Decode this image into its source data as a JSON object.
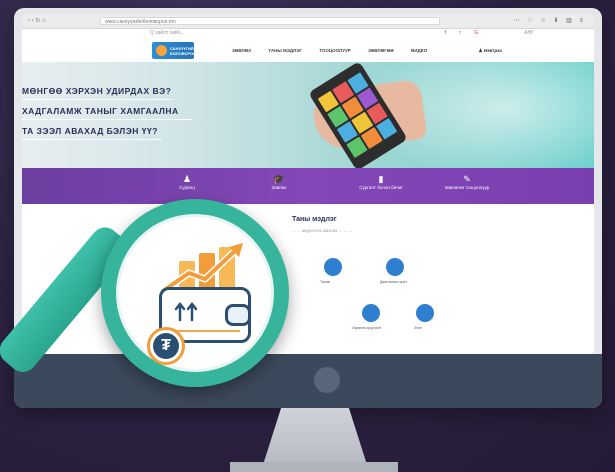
{
  "browser": {
    "nav_controls": "‹ › ↻ ⌂",
    "url": "www.санхүүгийнболовсрол.mn",
    "toolbar_icons": "⋯ ♡ ☆   ⬇ ▥ ≡"
  },
  "site": {
    "top": {
      "search_placeholder": "Q  хайлт хийх...",
      "social": [
        "f",
        "t",
        "G"
      ],
      "lang": "АНГ"
    },
    "logo_text": "САНХҮҮГИЙН БОЛОВСРОЛ",
    "menu": [
      "ЗӨВЛӨХ",
      "ТАНЫ МЭДЛЭГ",
      "ТООЦООЛУУР",
      "ЗӨВЛӨГӨӨ",
      "ВИДЕО"
    ],
    "login": "♟ Нэвтрэх"
  },
  "hero": {
    "lines": [
      "МӨНГӨӨ ХЭРХЭН УДИРДАХ ВЭ?",
      "ХАДГАЛАМЖ ТАНЫГ ХАМГААЛНА",
      "ТА ЗЭЭЛ АВАХАД БЭЛЭН ҮҮ?"
    ]
  },
  "purple_bar": {
    "items": [
      {
        "icon": "user-icon",
        "glyph": "♟",
        "label": "Суралц"
      },
      {
        "icon": "graduation-cap-icon",
        "glyph": "🎓",
        "label": "Зөвлөх"
      },
      {
        "icon": "document-icon",
        "glyph": "▮",
        "label": "Сургалт болон бичиг"
      },
      {
        "icon": "pen-icon",
        "glyph": "✎",
        "label": "Зөвлөгөө тооцоолуур"
      }
    ]
  },
  "content": {
    "title": "Таны мэдлэг",
    "subtitle": "... ... мэдлэгээ шалгах ... ... ...",
    "services": [
      {
        "label": "Төсөв"
      },
      {
        "label": "Даатгалын гэрээ"
      },
      {
        "label": "Хөрөнгө оруулалт"
      },
      {
        "label": "Зээл"
      }
    ]
  },
  "illustration": {
    "currency_symbol": "₮",
    "colors": {
      "orange": "#f39c3a",
      "navy": "#2b4f72",
      "teal": "#36b59c",
      "purple": "#7a3fae"
    }
  }
}
